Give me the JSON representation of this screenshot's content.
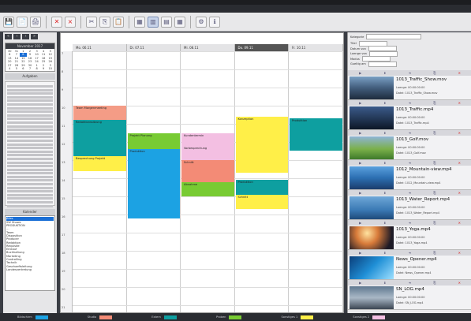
{
  "menu": [
    " ",
    " ",
    " ",
    " ",
    " ",
    " ",
    " "
  ],
  "colors": {
    "pink": "#f49c86",
    "teal": "#0e9fa0",
    "yellow": "#ffef48",
    "green": "#78cb33",
    "blue": "#1ca2e3",
    "lilac": "#f3bfe2",
    "salmon": "#f38b76",
    "dayHeaderCurrent": "#555555",
    "selection": "#1b6fd6"
  },
  "toolbar": {
    "icons": [
      "save-icon",
      "new-icon",
      "print-icon",
      "delete-icon",
      "close-icon",
      "cut-icon",
      "copy-icon",
      "paste-icon",
      "calendar-icon",
      "day-view-icon",
      "week-view-icon",
      "month-view-icon",
      "settings-icon",
      "info-icon"
    ]
  },
  "sidebar": {
    "month_title": "November 2017",
    "days": [
      "30",
      "31",
      "1",
      "2",
      "3",
      "4",
      "5",
      "6",
      "7",
      "8",
      "9",
      "10",
      "11",
      "12",
      "13",
      "14",
      "15",
      "16",
      "17",
      "18",
      "19",
      "20",
      "21",
      "22",
      "23",
      "24",
      "25",
      "26",
      "27",
      "28",
      "29",
      "30",
      "1",
      "2",
      "3",
      "4",
      "5",
      "6",
      "7",
      "8",
      "9",
      "10"
    ],
    "today_index": 9,
    "tasks_title": "Aufgaben",
    "calendars_title": "Kalender",
    "calendars": [
      "Alles",
      "SW Shows",
      "PRODUKTION",
      "…",
      "Team",
      "Disposition",
      "Producer",
      "Redaktion",
      "Requisite",
      "Einkauf",
      "Buchhaltung",
      "Marketing",
      "Controlling",
      "Technik",
      "Geschaeftsleitung",
      "Landesvertretung"
    ],
    "calendar_selected_index": 0
  },
  "calendar": {
    "days": [
      "Mo. 06.11",
      "Di. 07.11",
      "Mi. 08.11",
      "Do. 09.11",
      "Fr. 10.11"
    ],
    "current_day_index": 3,
    "times": [
      "7",
      "8",
      "9",
      "10",
      "11",
      "12",
      "13",
      "14",
      "15",
      "16",
      "17",
      "18",
      "19",
      "20",
      "21"
    ],
    "events": [
      {
        "title": "Team Morgenmeeting",
        "day": 0,
        "start_hour": 10.0,
        "end_hour": 10.8,
        "color": "#f49c86"
      },
      {
        "title": "Redaktionssitzung",
        "day": 0,
        "start_hour": 10.8,
        "end_hour": 12.8,
        "color": "#0e9fa0"
      },
      {
        "title": "Besprechung Projekt",
        "day": 0,
        "start_hour": 12.8,
        "end_hour": 13.6,
        "color": "#ffef48"
      },
      {
        "title": "Projekt Planung",
        "day": 1,
        "start_hour": 11.5,
        "end_hour": 12.4,
        "color": "#78cb33"
      },
      {
        "title": "Produktion",
        "day": 1,
        "start_hour": 12.4,
        "end_hour": 16.2,
        "color": "#1ca2e3"
      },
      {
        "title": "Kundentermin",
        "day": 2,
        "start_hour": 11.5,
        "end_hour": 12.2,
        "color": "#f3bfe2"
      },
      {
        "title": "Vorbesprechung",
        "day": 2,
        "start_hour": 12.2,
        "end_hour": 13.0,
        "color": "#f3bfe2"
      },
      {
        "title": "Schnitt",
        "day": 2,
        "start_hour": 13.0,
        "end_hour": 14.2,
        "color": "#f38b76"
      },
      {
        "title": "Abnahme",
        "day": 2,
        "start_hour": 14.2,
        "end_hour": 15.0,
        "color": "#78cb33"
      },
      {
        "title": "Konzeption",
        "day": 3,
        "start_hour": 10.6,
        "end_hour": 13.7,
        "color": "#ffef48"
      },
      {
        "title": "Produktion",
        "day": 3,
        "start_hour": 14.1,
        "end_hour": 14.9,
        "color": "#0e9fa0"
      },
      {
        "title": "Schnitt",
        "day": 3,
        "start_hour": 14.9,
        "end_hour": 15.7,
        "color": "#ffef48"
      },
      {
        "title": "Produktion",
        "day": 4,
        "start_hour": 10.7,
        "end_hour": 12.5,
        "color": "#0e9fa0"
      }
    ]
  },
  "assets_panel": {
    "filters": [
      "Kategorie",
      "Titel",
      "Datum von",
      "Laenge von",
      "Modus",
      "Gueltig am"
    ],
    "items": [
      {
        "name": "1013_Traffic_Show.mov",
        "meta1": "Laenge: 00:00:00:00",
        "meta2": "Datei: 1013_Traffic_Show.mov",
        "thumb": "linear-gradient(180deg,#7aa0c4 0%,#425d7c 50%,#1e2b3d 100%)"
      },
      {
        "name": "1013_Traffic.mp4",
        "meta1": "Laenge: 00:00:00:00",
        "meta2": "Datei: 1013_Traffic.mp4",
        "thumb": "linear-gradient(180deg,#3b5a8a 0%,#223654 55%,#0d1626 100%)"
      },
      {
        "name": "1013_Golf.mov",
        "meta1": "Laenge: 00:00:00:00",
        "meta2": "Datei: 1013_Golf.mov",
        "thumb": "linear-gradient(180deg,#8fb4d6 0%,#7bb04a 55%,#3e7a2a 100%)"
      },
      {
        "name": "1012_Mountain-view.mp4",
        "meta1": "Laenge: 00:00:00:00",
        "meta2": "Datei: 1012_Mountain-view.mp4",
        "thumb": "linear-gradient(180deg,#5aa0dd 0%,#2c6fb2 50%,#1b3c6b 100%)"
      },
      {
        "name": "1013_Water_Report.mp4",
        "meta1": "Laenge: 00:00:00:00",
        "meta2": "Datei: 1013_Water_Report.mp4",
        "thumb": "linear-gradient(180deg,#6fa7d8 0%,#3a79b4 60%,#1e4a7a 100%)"
      },
      {
        "name": "1013_Yoga.mp4",
        "meta1": "Laenge: 00:00:00:00",
        "meta2": "Datei: 1013_Yoga.mp4",
        "thumb": "radial-gradient(circle at 40% 30%,#ffe3a0 0%,#d87b3a 35%,#1d1a26 80%)"
      },
      {
        "name": "News_Opener.mp4",
        "meta1": "Laenge: 00:00:00:00",
        "meta2": "Datei: News_Opener.mp4",
        "thumb": "linear-gradient(135deg,#0b3e7a 0%,#1f8fd6 50%,#9ee0ff 100%)"
      },
      {
        "name": "SN_LOG.mp4",
        "meta1": "Laenge: 00:00:00:00",
        "meta2": "Datei: SN_LOG.mp4",
        "thumb": "linear-gradient(180deg,#5f7890 0%,#a9b8c6 50%,#3b4552 100%)"
      }
    ]
  },
  "legend": [
    {
      "label": "Bildschirm",
      "color": "#1ca2e3"
    },
    {
      "label": "Studio",
      "color": "#f38b76"
    },
    {
      "label": "Extern",
      "color": "#0e9fa0"
    },
    {
      "label": "Proben",
      "color": "#78cb33"
    },
    {
      "label": "Sonstiges 1",
      "color": "#ffef48"
    },
    {
      "label": "Sonstiges 2",
      "color": "#f3bfe2"
    }
  ]
}
